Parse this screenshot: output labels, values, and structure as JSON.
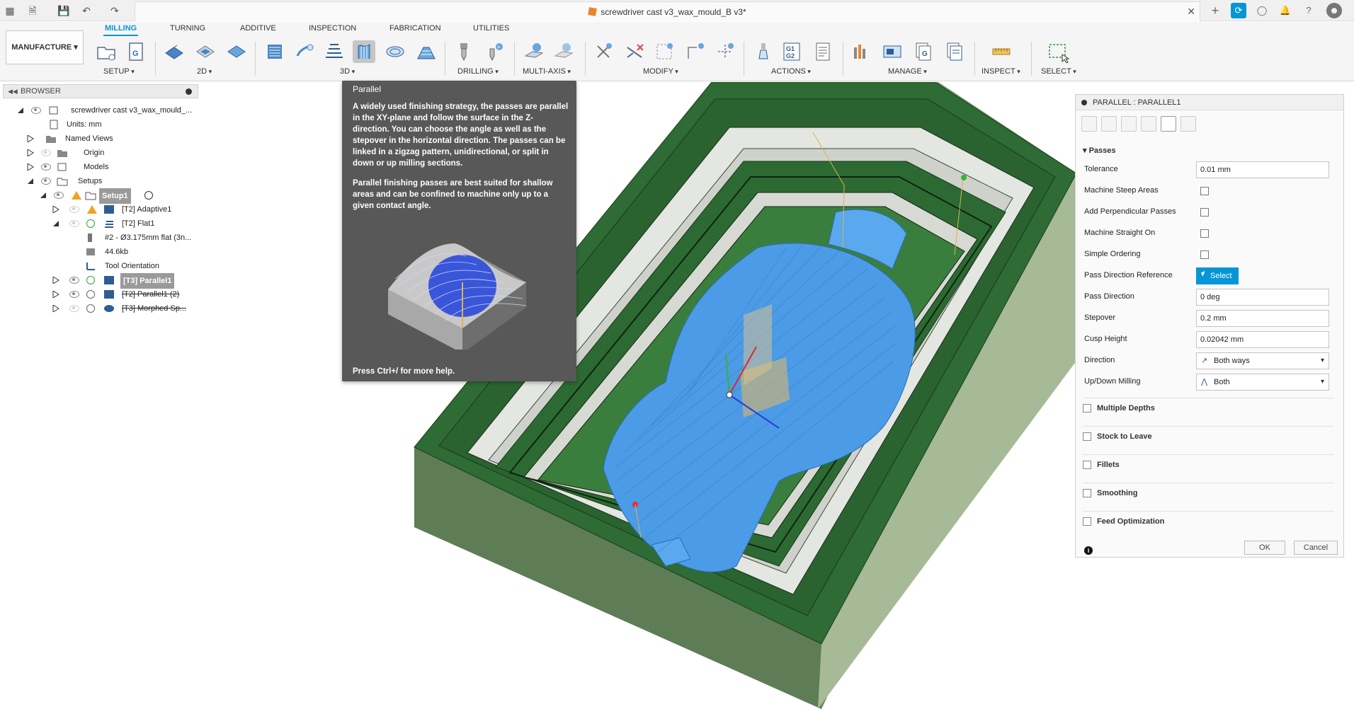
{
  "window": {
    "title": "screwdriver cast v3_wax_mould_B v3*"
  },
  "workspace": {
    "label": "MANUFACTURE"
  },
  "ribbon": {
    "tabs": [
      "MILLING",
      "TURNING",
      "ADDITIVE",
      "INSPECTION",
      "FABRICATION",
      "UTILITIES"
    ],
    "active_tab": "MILLING",
    "groups": [
      "SETUP",
      "2D",
      "3D",
      "DRILLING",
      "MULTI-AXIS",
      "MODIFY",
      "ACTIONS",
      "MANAGE",
      "INSPECT",
      "SELECT"
    ]
  },
  "browser": {
    "title": "BROWSER",
    "rows": [
      {
        "label": "screwdriver cast v3_wax_mould_..."
      },
      {
        "label": "Units: mm"
      },
      {
        "label": "Named Views"
      },
      {
        "label": "Origin"
      },
      {
        "label": "Models"
      },
      {
        "label": "Setups"
      },
      {
        "label": "Setup1"
      },
      {
        "label": "[T2] Adaptive1"
      },
      {
        "label": "[T2] Flat1"
      },
      {
        "label": "#2 - Ø3.175mm flat (3n..."
      },
      {
        "label": "44.6kb"
      },
      {
        "label": "Tool Orientation"
      },
      {
        "label": "[T3] Parallel1"
      },
      {
        "label": "[T2] Parallel1 (2)"
      },
      {
        "label": "[T3] Morphed Sp..."
      }
    ]
  },
  "tooltip": {
    "title": "Parallel",
    "para1": "A widely used finishing strategy, the passes are parallel in the XY-plane and follow the surface in the Z-direction. You can choose the angle as well as the stepover in the horizontal direction. The passes can be linked in a zigzag pattern, unidirectional, or split in down or up milling sections.",
    "para2": "Parallel finishing passes are best suited for shallow areas and can be confined to machine only up to a given contact angle.",
    "footer": "Press Ctrl+/ for more help."
  },
  "panel": {
    "title": "PARALLEL : PARALLEL1",
    "section": "Passes",
    "fields": [
      {
        "label": "Tolerance",
        "value": "0.01 mm"
      },
      {
        "label": "Machine Steep Areas"
      },
      {
        "label": "Add Perpendicular Passes"
      },
      {
        "label": "Machine Straight On"
      },
      {
        "label": "Simple Ordering"
      },
      {
        "label": "Pass Direction Reference",
        "value": "Select"
      },
      {
        "label": "Pass Direction",
        "value": "0 deg"
      },
      {
        "label": "Stepover",
        "value": "0.2 mm"
      },
      {
        "label": "Cusp Height",
        "value": "0.02042 mm"
      },
      {
        "label": "Direction",
        "value": "Both ways"
      },
      {
        "label": "Up/Down Milling",
        "value": "Both"
      }
    ],
    "collapsed_sections": [
      "Multiple Depths",
      "Stock to Leave",
      "Fillets",
      "Smoothing",
      "Feed Optimization"
    ],
    "ok": "OK",
    "cancel": "Cancel"
  }
}
